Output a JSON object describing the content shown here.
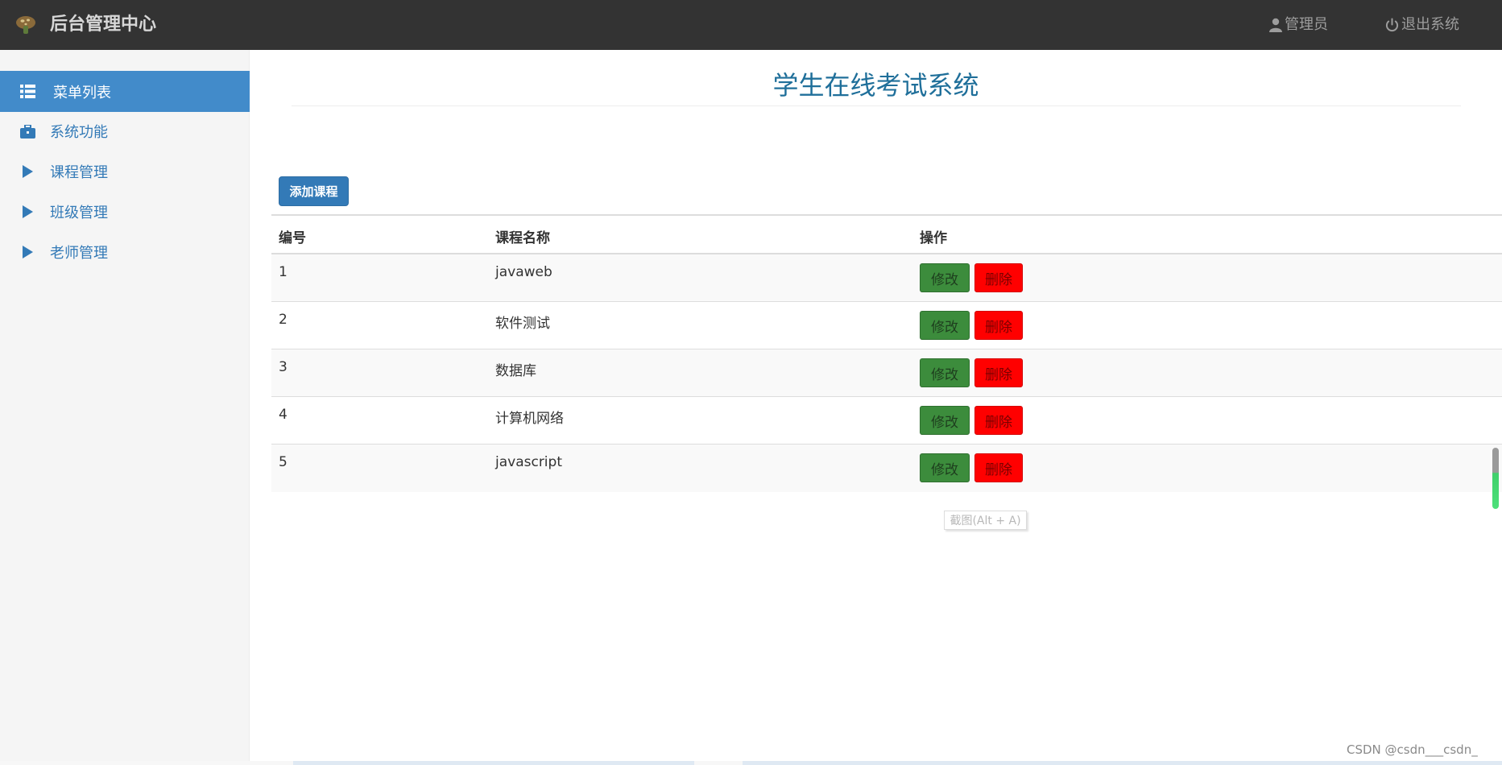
{
  "header": {
    "brand": "后台管理中心",
    "admin_label": "管理员",
    "logout_label": "退出系统"
  },
  "sidebar": {
    "menu_title": "菜单列表",
    "items": [
      {
        "label": "系统功能",
        "icon": "briefcase-icon"
      },
      {
        "label": "课程管理",
        "icon": "triangle-right-icon"
      },
      {
        "label": "班级管理",
        "icon": "triangle-right-icon"
      },
      {
        "label": "老师管理",
        "icon": "triangle-right-icon"
      }
    ]
  },
  "main": {
    "title": "学生在线考试系统",
    "add_button": "添加课程",
    "table": {
      "headers": [
        "编号",
        "课程名称",
        "操作"
      ],
      "rows": [
        {
          "id": "1",
          "name": "javaweb"
        },
        {
          "id": "2",
          "name": "软件测试"
        },
        {
          "id": "3",
          "name": "数据库"
        },
        {
          "id": "4",
          "name": "计算机网络"
        },
        {
          "id": "5",
          "name": "javascript"
        }
      ],
      "edit_label": "修改",
      "delete_label": "删除"
    }
  },
  "tooltip": "截图(Alt + A)",
  "watermark": "CSDN @csdn___csdn_",
  "colors": {
    "topbar": "#333333",
    "sidebar_active": "#428bca",
    "link": "#337ab7",
    "edit": "#3c8c3c",
    "delete": "#ff0000"
  }
}
